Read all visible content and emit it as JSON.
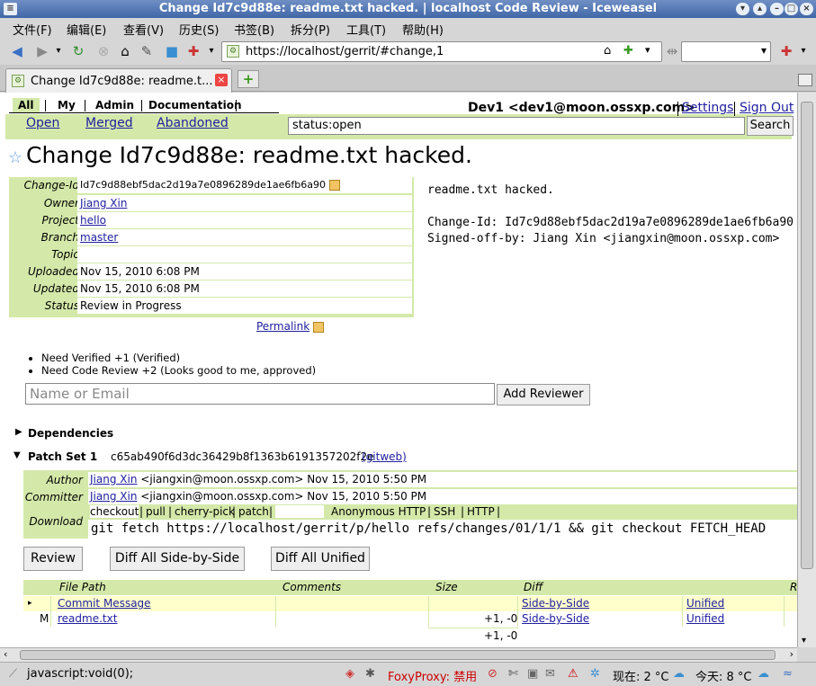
{
  "window": {
    "title": "Change Id7c9d88e: readme.txt hacked. | localhost Code Review - Iceweasel"
  },
  "menubar": [
    "文件(F)",
    "编辑(E)",
    "查看(V)",
    "历史(S)",
    "书签(B)",
    "拆分(P)",
    "工具(T)",
    "帮助(H)"
  ],
  "navbar": {
    "url": "https://localhost/gerrit/#change,1"
  },
  "tab": {
    "label": "Change Id7c9d88e: readme.t..."
  },
  "gerrit": {
    "menu": [
      "All",
      "My",
      "Admin",
      "Documentation"
    ],
    "submenu": [
      "Open",
      "Merged",
      "Abandoned"
    ],
    "user": "Dev1 <dev1@moon.ossxp.com>",
    "settings": "Settings",
    "signout": "Sign Out",
    "query": "status:open",
    "search_label": "Search"
  },
  "change": {
    "title": "Change Id7c9d88e: readme.txt hacked.",
    "fields": [
      {
        "key": "Change-Id",
        "value": "Id7c9d88ebf5dac2d19a7e0896289de1ae6fb6a90"
      },
      {
        "key": "Owner",
        "value": "Jiang Xin"
      },
      {
        "key": "Project",
        "value": "hello"
      },
      {
        "key": "Branch",
        "value": "master"
      },
      {
        "key": "Topic",
        "value": ""
      },
      {
        "key": "Uploaded",
        "value": "Nov 15, 2010 6:08 PM"
      },
      {
        "key": "Updated",
        "value": "Nov 15, 2010 6:08 PM"
      },
      {
        "key": "Status",
        "value": "Review in Progress"
      }
    ],
    "message": "readme.txt hacked.\n\nChange-Id: Id7c9d88ebf5dac2d19a7e0896289de1ae6fb6a90\nSigned-off-by: Jiang Xin <jiangxin@moon.ossxp.com>",
    "permalink": "Permalink",
    "requirements": [
      "Need Verified +1 (Verified)",
      "Need Code Review +2 (Looks good to me, approved)"
    ],
    "reviewer_placeholder": "Name or Email",
    "add_reviewer_label": "Add Reviewer",
    "dependencies_label": "Dependencies"
  },
  "patchset": {
    "label": "Patch Set 1",
    "commit": "c65ab490f6d3dc36429b8f1363b6191357202f2e",
    "gitweb": "(gitweb)",
    "author_key": "Author",
    "author_name": "Jiang Xin",
    "author_rest": "<jiangxin@moon.ossxp.com> Nov 15, 2010 5:50 PM",
    "committer_key": "Committer",
    "committer_name": "Jiang Xin",
    "committer_rest": "<jiangxin@moon.ossxp.com> Nov 15, 2010 5:50 PM",
    "download_key": "Download",
    "download_tabs": [
      "checkout",
      "pull",
      "cherry-pick",
      "patch",
      "Anonymous HTTP",
      "SSH",
      "HTTP"
    ],
    "download_cmd": "git fetch https://localhost/gerrit/p/hello refs/changes/01/1/1 && git checkout FETCH_HEAD",
    "review_label": "Review",
    "diff_sbs_label": "Diff All Side-by-Side",
    "diff_unified_label": "Diff All Unified"
  },
  "files": {
    "headers": [
      "File Path",
      "Comments",
      "Size",
      "Diff",
      "R"
    ],
    "rows": [
      {
        "marker": "▸",
        "path": "Commit Message",
        "size": "",
        "sbs": "Side-by-Side",
        "unified": "Unified"
      },
      {
        "marker": "M",
        "path": "readme.txt",
        "size": "+1, -0",
        "sbs": "Side-by-Side",
        "unified": "Unified"
      }
    ],
    "total_size": "+1, -0"
  },
  "statusbar": {
    "text": "javascript:void(0);",
    "foxyproxy": "FoxyProxy: 禁用",
    "weather_now": "现在: 2 °C",
    "weather_today": "今天: 8 °C"
  }
}
